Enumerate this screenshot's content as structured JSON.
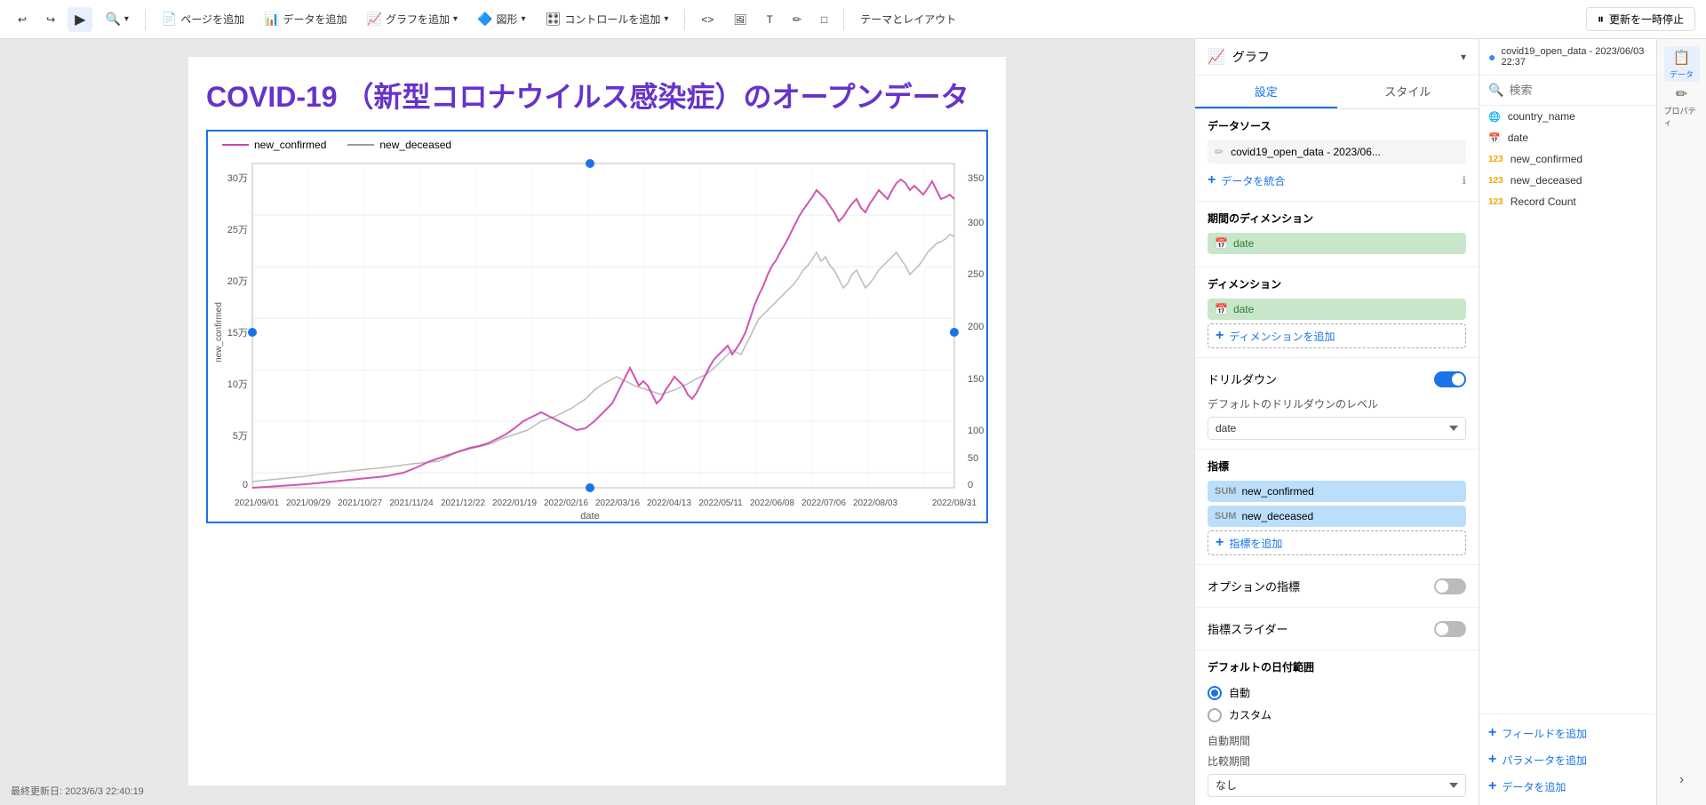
{
  "toolbar": {
    "undo_label": "↩",
    "redo_label": "↪",
    "cursor_label": "▲",
    "zoom_label": "🔍",
    "add_page_label": "ページを追加",
    "add_data_label": "データを追加",
    "add_graph_label": "グラフを追加",
    "add_shape_label": "図形",
    "add_control_label": "コントロールを追加",
    "code_label": "<>",
    "image_label": "🖼",
    "text_label": "T",
    "draw_label": "✏",
    "shape_label": "□",
    "theme_label": "テーマとレイアウト",
    "pause_label": "更新を一時停止"
  },
  "page": {
    "title": "COVID-19 （新型コロナウイルス感染症）のオープンデータ",
    "status": "最終更新日: 2023/6/3 22:40:19",
    "chart": {
      "legend_confirmed": "new_confirmed",
      "legend_deceased": "new_deceased",
      "x_axis_label": "date",
      "left_axis_label": "new_confirmed",
      "y_left_ticks": [
        "30万",
        "25万",
        "20万",
        "15万",
        "10万",
        "5万",
        "0"
      ],
      "y_right_ticks": [
        "350",
        "300",
        "250",
        "200",
        "150",
        "100",
        "50",
        "0"
      ],
      "x_ticks": [
        "2021/09/01",
        "2021/09/29",
        "2021/10/27",
        "2021/11/24",
        "2021/12/22",
        "2022/01/19",
        "2022/02/16",
        "2022/03/16",
        "2022/04/13",
        "2022/05/11",
        "2022/06/08",
        "2022/07/06",
        "2022/08/03",
        "2022/08/31"
      ]
    }
  },
  "graph_panel": {
    "title": "グラフ",
    "tab_settings": "設定",
    "tab_style": "スタイル",
    "data_source_section": "データソース",
    "data_source_name": "covid19_open_data - 2023/06...",
    "merge_data_label": "データを統合",
    "period_dimension_label": "期間のディメンション",
    "dimension_label": "ディメンション",
    "dimension_value": "date",
    "add_dimension_label": "ディメンションを追加",
    "drilldown_label": "ドリルダウン",
    "drilldown_level_label": "デフォルトのドリルダウンのレベル",
    "drilldown_level_value": "date",
    "metric_label": "指標",
    "metric1": "new_confirmed",
    "metric2": "new_deceased",
    "add_metric_label": "指標を追加",
    "optional_metric_label": "オプションの指標",
    "metric_slider_label": "指標スライダー",
    "date_range_label": "デフォルトの日付範囲",
    "auto_label": "自動",
    "custom_label": "カスタム",
    "auto_period_label": "自動期間",
    "compare_period_label": "比較期間",
    "none_label": "なし"
  },
  "data_panel": {
    "title": "データ",
    "search_placeholder": "検索",
    "data_source": "covid19_open_data - 2023/06/03 22:37",
    "fields": [
      {
        "name": "country_name",
        "type": "geo",
        "icon": "🌐"
      },
      {
        "name": "date",
        "type": "date",
        "icon": "📅"
      },
      {
        "name": "new_confirmed",
        "type": "number",
        "icon": "123"
      },
      {
        "name": "new_deceased",
        "type": "number",
        "icon": "123"
      },
      {
        "name": "Record Count",
        "type": "number",
        "icon": "123"
      }
    ],
    "add_field_label": "フィールドを追加",
    "add_parameter_label": "パラメータを追加",
    "add_data_label": "データを追加"
  },
  "panel_icons": {
    "data_label": "データ",
    "property_label": "プロパティ"
  }
}
